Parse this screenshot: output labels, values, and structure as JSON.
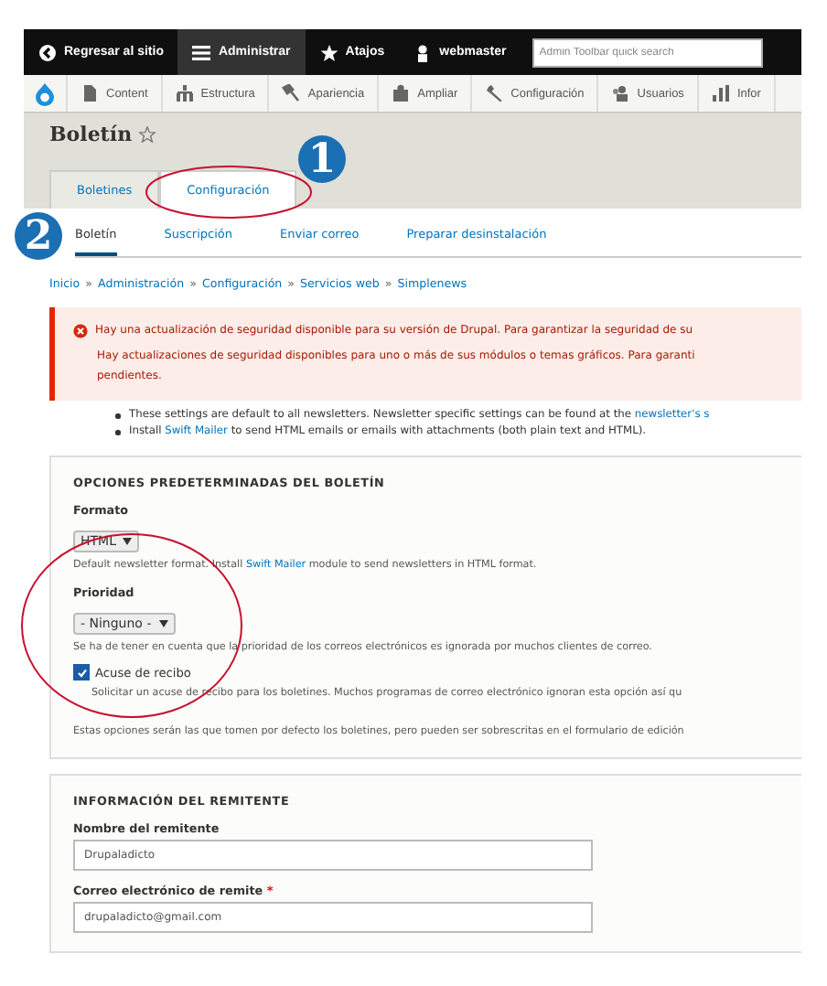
{
  "toolbar": {
    "items": [
      {
        "label": "Regresar al sitio",
        "selected": false
      },
      {
        "label": "Administrar",
        "selected": true
      },
      {
        "label": "Atajos",
        "selected": false
      },
      {
        "label": "webmaster",
        "selected": false
      }
    ],
    "search": {
      "placeholder": "Admin Toolbar quick search"
    }
  },
  "admin_menu": [
    "Content",
    "Estructura",
    "Apariencia",
    "Ampliar",
    "Configuración",
    "Usuarios",
    "Infor"
  ],
  "page_title": "Boletín",
  "primary_tabs": [
    {
      "label": "Boletines",
      "selected": false
    },
    {
      "label": "Configuración",
      "selected": true
    }
  ],
  "secondary_tabs": [
    {
      "label": "Boletín",
      "selected": true
    },
    {
      "label": "Suscripción",
      "selected": false
    },
    {
      "label": "Enviar correo",
      "selected": false
    },
    {
      "label": "Preparar desinstalación",
      "selected": false
    }
  ],
  "breadcrumb": [
    "Inicio",
    "Administración",
    "Configuración",
    "Servicios web",
    "Simplenews"
  ],
  "breadcrumb_separator": "»",
  "error_messages": [
    "Hay una actualización de seguridad disponible para su versión de Drupal. Para garantizar la seguridad de su",
    "Hay actualizaciones de seguridad disponibles para uno o más de sus módulos o temas gráficos. Para garanti",
    "pendientes."
  ],
  "notes": [
    {
      "before": "These settings are default to all newsletters. Newsletter specific settings can be found at the ",
      "link": "newsletter's s"
    },
    {
      "before": "Install ",
      "link": "Swift Mailer",
      "after": " to send HTML emails or emails with attachments (both plain text and HTML)."
    }
  ],
  "fieldsets": [
    {
      "title": "OPCIONES PREDETERMINADAS DEL BOLETÍN",
      "fields": [
        {
          "kind": "select",
          "label": "Formato",
          "value": "HTML",
          "description": {
            "before": "Default newsletter format. Install ",
            "link": "Swift Mailer",
            "after": " module to send newsletters in HTML format."
          }
        },
        {
          "kind": "select",
          "label": "Prioridad",
          "value": "- Ninguno -",
          "description": {
            "before": "Se ha de tener en cuenta que la prioridad de los correos electrónicos es ignorada por muchos clientes de correo."
          }
        },
        {
          "kind": "checkbox",
          "label": "Acuse de recibo",
          "checked": true,
          "description": {
            "before": "Solicitar un acuse de recibo para los boletines. Muchos programas de correo electrónico ignoran esta opción así qu"
          }
        },
        {
          "kind": "note",
          "description": {
            "before": "Estas opciones serán las que tomen por defecto los boletines, pero pueden ser sobrescritas en el formulario de edición"
          }
        }
      ]
    },
    {
      "title": "INFORMACIÓN DEL REMITENTE",
      "fields": [
        {
          "kind": "text",
          "label": "Nombre del remitente",
          "value": "Drupaladicto"
        },
        {
          "kind": "text",
          "label": "Correo electrónico de remite",
          "value": "drupaladicto@gmail.com",
          "required_mark": "*"
        }
      ]
    }
  ],
  "annotation_markers": [
    "1",
    "2"
  ]
}
